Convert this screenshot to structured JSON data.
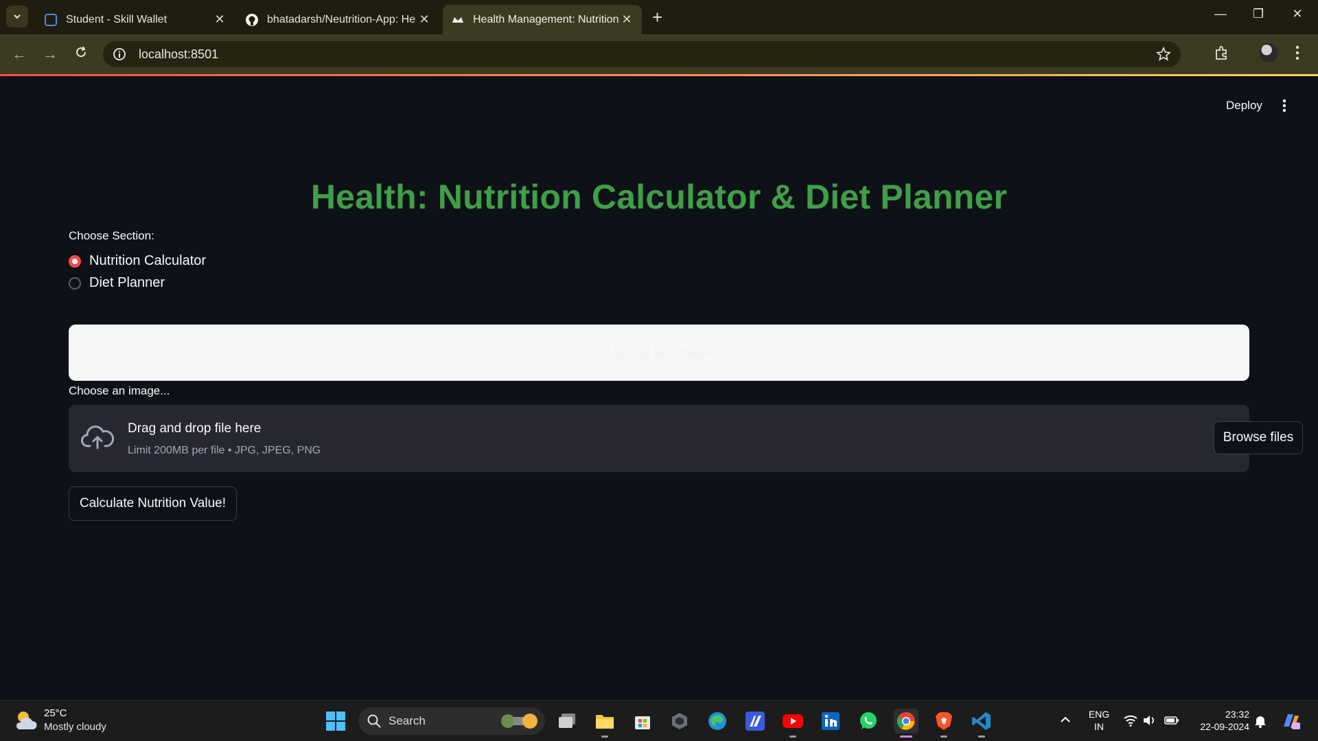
{
  "browser": {
    "tabs": [
      {
        "title": "Student - Skill Wallet",
        "icon": "skillwallet-icon",
        "active": false
      },
      {
        "title": "bhatadarsh/Neutrition-App: He",
        "icon": "github-icon",
        "active": false
      },
      {
        "title": "Health Management: Nutrition",
        "icon": "streamlit-icon",
        "active": true
      }
    ],
    "url": "localhost:8501",
    "accent_colors": [
      "#ff4b4b",
      "#ff9a55",
      "#ffd36b"
    ]
  },
  "app": {
    "deploy_label": "Deploy",
    "title": "Health: Nutrition Calculator & Diet Planner",
    "title_color": "#3f9f47",
    "section_label": "Choose Section:",
    "sections": [
      {
        "label": "Nutrition Calculator",
        "selected": true
      },
      {
        "label": "Diet Planner",
        "selected": false
      }
    ],
    "upload_header_text": "Upload an Image",
    "choose_image_label": "Choose an image...",
    "dropzone": {
      "title": "Drag and drop file here",
      "subtitle": "Limit 200MB per file • JPG, JPEG, PNG",
      "browse_label": "Browse files"
    },
    "calculate_label": "Calculate Nutrition Value!"
  },
  "taskbar": {
    "weather": {
      "temp": "25°C",
      "desc": "Mostly cloudy"
    },
    "search_label": "Search",
    "apps": [
      "windows-start-icon",
      "task-view-icon",
      "file-explorer-icon",
      "microsoft-store-icon",
      "settings-app-icon",
      "edge-icon",
      "ai-app-icon",
      "youtube-icon",
      "linkedin-icon",
      "whatsapp-icon",
      "chrome-icon",
      "brave-icon",
      "vscode-icon"
    ],
    "language_top": "ENG",
    "language_bottom": "IN",
    "time": "23:32",
    "date": "22-09-2024"
  }
}
